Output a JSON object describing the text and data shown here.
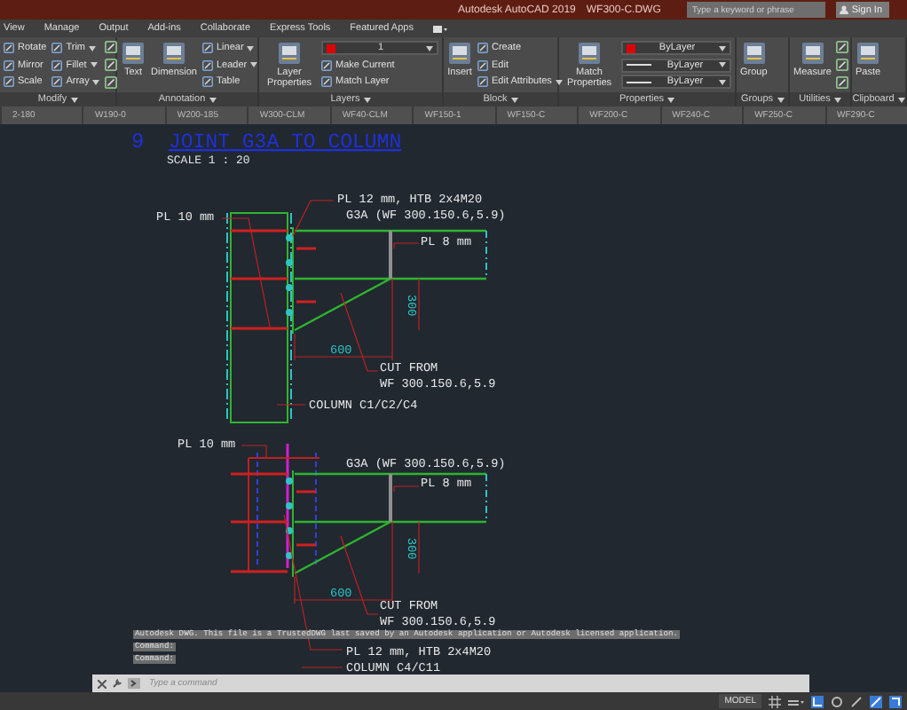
{
  "title_bar": {
    "title": "Autodesk AutoCAD 2019",
    "file": "WF300-C.DWG",
    "search": {
      "placeholder": "Type a keyword or phrase"
    },
    "sign_in": "Sign In"
  },
  "ribbon_tabs": [
    "View",
    "Manage",
    "Output",
    "Add-ins",
    "Collaborate",
    "Express Tools",
    "Featured Apps"
  ],
  "ribbon_panels": [
    {
      "label": "Modify",
      "columns": [
        [
          {
            "kind": "small",
            "label": "Rotate",
            "menu": false
          },
          {
            "kind": "small",
            "label": "Mirror",
            "menu": false
          },
          {
            "kind": "small",
            "label": "Scale",
            "menu": false
          }
        ],
        [
          {
            "kind": "small",
            "label": "Trim",
            "menu": true
          },
          {
            "kind": "small",
            "label": "Fillet",
            "menu": true
          },
          {
            "kind": "small",
            "label": "Array",
            "menu": true
          }
        ],
        [
          {
            "kind": "icon"
          },
          {
            "kind": "icon"
          },
          {
            "kind": "icon"
          }
        ]
      ]
    },
    {
      "label": "Annotation",
      "columns": [
        [
          {
            "kind": "large",
            "label": "Text"
          }
        ],
        [
          {
            "kind": "large",
            "label": "Dimension"
          }
        ],
        [
          {
            "kind": "small",
            "label": "Linear",
            "menu": true
          },
          {
            "kind": "small",
            "label": "Leader",
            "menu": true
          },
          {
            "kind": "small",
            "label": "Table",
            "menu": false
          }
        ]
      ]
    },
    {
      "label": "Layers",
      "columns": [
        [
          {
            "kind": "large",
            "label": "Layer Properties"
          }
        ],
        [
          {
            "kind": "dropdown",
            "label": "1",
            "color": "#e00000"
          },
          {
            "kind": "small",
            "label": "Make Current",
            "menu": false
          },
          {
            "kind": "small",
            "label": "Match Layer",
            "menu": false
          }
        ]
      ]
    },
    {
      "label": "Block",
      "columns": [
        [
          {
            "kind": "large",
            "label": "Insert"
          }
        ],
        [
          {
            "kind": "small",
            "label": "Create",
            "menu": false
          },
          {
            "kind": "small",
            "label": "Edit",
            "menu": false
          },
          {
            "kind": "small",
            "label": "Edit Attributes",
            "menu": true
          }
        ]
      ]
    },
    {
      "label": "Properties",
      "columns": [
        [
          {
            "kind": "large",
            "label": "Match Properties"
          }
        ],
        [
          {
            "kind": "dropdown",
            "label": "ByLayer",
            "color": "#e00000"
          },
          {
            "kind": "dropdown",
            "label": "ByLayer"
          },
          {
            "kind": "dropdown",
            "label": "ByLayer"
          }
        ]
      ]
    },
    {
      "label": "Groups",
      "columns": [
        [
          {
            "kind": "large",
            "label": "Group"
          }
        ]
      ]
    },
    {
      "label": "Utilities",
      "columns": [
        [
          {
            "kind": "large",
            "label": "Measure"
          }
        ],
        [
          {
            "kind": "icon"
          },
          {
            "kind": "icon"
          },
          {
            "kind": "icon"
          }
        ]
      ]
    },
    {
      "label": "Clipboard",
      "columns": [
        [
          {
            "kind": "large",
            "label": "Paste"
          }
        ]
      ]
    }
  ],
  "file_tabs": [
    "2-180",
    "W190-0",
    "W200-185",
    "W300-CLM",
    "WF40-CLM",
    "WF150-1",
    "WF150-C",
    "WF200-C",
    "WF240-C",
    "WF250-C",
    "WF290-C"
  ],
  "drawing": {
    "number": "9",
    "title": "JOINT G3A TO COLUMN",
    "scale": "SCALE  1 : 20",
    "details": [
      {
        "annotations": [
          {
            "kind": "label",
            "text": "PL 10 mm"
          },
          {
            "kind": "label",
            "text": "PL 12 mm, HTB 2x4M20"
          },
          {
            "kind": "label",
            "text": "G3A (WF 300.150.6,5.9)"
          },
          {
            "kind": "label",
            "text": "PL 8 mm"
          },
          {
            "kind": "dimension",
            "text": "300"
          },
          {
            "kind": "dimension",
            "text": "600"
          },
          {
            "kind": "label",
            "text": "CUT FROM"
          },
          {
            "kind": "label",
            "text": "WF 300.150.6,5.9"
          },
          {
            "kind": "label",
            "text": "COLUMN C1/C2/C4"
          }
        ]
      },
      {
        "annotations": [
          {
            "kind": "label",
            "text": "PL 10 mm"
          },
          {
            "kind": "label",
            "text": "G3A (WF 300.150.6,5.9)"
          },
          {
            "kind": "label",
            "text": "PL 8 mm"
          },
          {
            "kind": "dimension",
            "text": "300"
          },
          {
            "kind": "dimension",
            "text": "600"
          },
          {
            "kind": "label",
            "text": "CUT FROM"
          },
          {
            "kind": "label",
            "text": "WF 300.150.6,5.9"
          },
          {
            "kind": "label",
            "text": "PL 12 mm, HTB 2x4M20"
          },
          {
            "kind": "label",
            "text": "COLUMN C4/C11"
          }
        ]
      }
    ]
  },
  "command_history": [
    "Autodesk DWG.  This file is a TrustedDWG last saved by an Autodesk application or Autodesk licensed application.",
    "Command:",
    "Command:"
  ],
  "command_line": {
    "placeholder": "Type a command"
  },
  "status_bar": {
    "model": "MODEL"
  }
}
